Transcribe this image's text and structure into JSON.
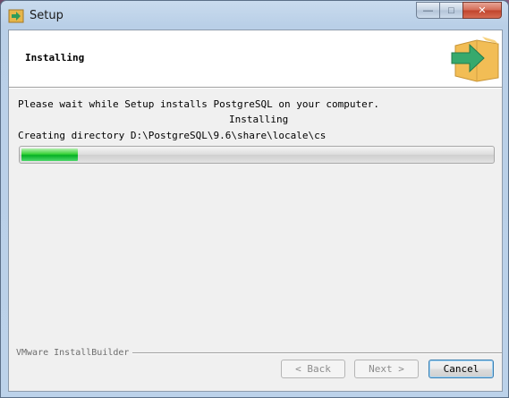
{
  "window": {
    "title": "Setup",
    "caption": {
      "minimize": "—",
      "maximize": "□",
      "close": "✕"
    }
  },
  "header": {
    "title": "Installing",
    "icon": "install-box-arrow-icon"
  },
  "body": {
    "message": "Please wait while Setup installs PostgreSQL on your computer.",
    "status": "Installing",
    "detail": "Creating directory D:\\PostgreSQL\\9.6\\share\\locale\\cs"
  },
  "progress": {
    "fraction": 0.12,
    "color": "#06b025"
  },
  "footer": {
    "brand": "VMware InstallBuilder",
    "back_label": "< Back",
    "next_label": "Next >",
    "cancel_label": "Cancel"
  }
}
